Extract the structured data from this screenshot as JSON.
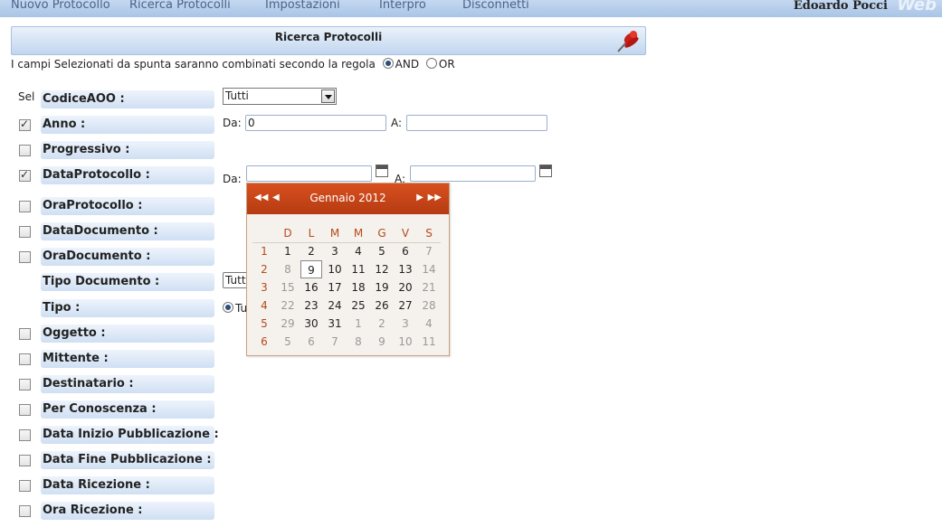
{
  "nav": {
    "items": [
      "Nuovo Protocollo",
      "Ricerca Protocolli",
      "Impostazioni",
      "Interpro",
      "Disconnetti"
    ],
    "user": "Edoardo Pocci",
    "brand": "Web"
  },
  "section": {
    "title": "Ricerca Protocolli"
  },
  "rule": {
    "text": "I campi Selezionati da spunta saranno combinati secondo la regola",
    "and": "AND",
    "or": "OR",
    "selected": "AND"
  },
  "sel_label": "Sel",
  "fields": [
    {
      "label": "CodiceAOO :",
      "check": "none"
    },
    {
      "label": "Anno :",
      "check": "checked"
    },
    {
      "label": "Progressivo :",
      "check": "unchecked"
    },
    {
      "label": "DataProtocollo :",
      "check": "checked"
    },
    {
      "label": "OraProtocollo :",
      "check": "unchecked"
    },
    {
      "label": "DataDocumento :",
      "check": "unchecked"
    },
    {
      "label": "OraDocumento :",
      "check": "unchecked"
    },
    {
      "label": "Tipo Documento :",
      "check": "none"
    },
    {
      "label": "Tipo :",
      "check": "none"
    },
    {
      "label": "Oggetto :",
      "check": "unchecked"
    },
    {
      "label": "Mittente :",
      "check": "unchecked"
    },
    {
      "label": "Destinatario :",
      "check": "unchecked"
    },
    {
      "label": "Per Conoscenza :",
      "check": "unchecked"
    },
    {
      "label": "Data Inizio Pubblicazione :",
      "check": "unchecked"
    },
    {
      "label": "Data Fine Pubblicazione :",
      "check": "unchecked"
    },
    {
      "label": "Data Ricezione :",
      "check": "unchecked"
    },
    {
      "label": "Ora Ricezione :",
      "check": "unchecked"
    }
  ],
  "codiceaoo": {
    "value": "Tutti"
  },
  "anno": {
    "da_label": "Da:",
    "a_label": "A:",
    "da_value": "0",
    "a_value": ""
  },
  "dataprot": {
    "da_label": "Da:",
    "a_label": "A:"
  },
  "tipodoc": {
    "value": "Tutti"
  },
  "tipo": {
    "value": "Tu"
  },
  "calendar": {
    "month": "Gennaio 2012",
    "dow": [
      "D",
      "L",
      "M",
      "M",
      "G",
      "V",
      "S"
    ],
    "weeks": [
      {
        "wk": "1",
        "days": [
          {
            "d": "1",
            "c": "cur"
          },
          {
            "d": "2",
            "c": "cur"
          },
          {
            "d": "3",
            "c": "cur"
          },
          {
            "d": "4",
            "c": "cur"
          },
          {
            "d": "5",
            "c": "cur"
          },
          {
            "d": "6",
            "c": "cur"
          },
          {
            "d": "7",
            "c": "oth"
          }
        ]
      },
      {
        "wk": "2",
        "days": [
          {
            "d": "8",
            "c": "oth"
          },
          {
            "d": "9",
            "c": "today"
          },
          {
            "d": "10",
            "c": "cur"
          },
          {
            "d": "11",
            "c": "cur"
          },
          {
            "d": "12",
            "c": "cur"
          },
          {
            "d": "13",
            "c": "cur"
          },
          {
            "d": "14",
            "c": "oth"
          }
        ]
      },
      {
        "wk": "3",
        "days": [
          {
            "d": "15",
            "c": "oth"
          },
          {
            "d": "16",
            "c": "cur"
          },
          {
            "d": "17",
            "c": "cur"
          },
          {
            "d": "18",
            "c": "cur"
          },
          {
            "d": "19",
            "c": "cur"
          },
          {
            "d": "20",
            "c": "cur"
          },
          {
            "d": "21",
            "c": "oth"
          }
        ]
      },
      {
        "wk": "4",
        "days": [
          {
            "d": "22",
            "c": "oth"
          },
          {
            "d": "23",
            "c": "cur"
          },
          {
            "d": "24",
            "c": "cur"
          },
          {
            "d": "25",
            "c": "cur"
          },
          {
            "d": "26",
            "c": "cur"
          },
          {
            "d": "27",
            "c": "cur"
          },
          {
            "d": "28",
            "c": "oth"
          }
        ]
      },
      {
        "wk": "5",
        "days": [
          {
            "d": "29",
            "c": "oth"
          },
          {
            "d": "30",
            "c": "cur"
          },
          {
            "d": "31",
            "c": "cur"
          },
          {
            "d": "1",
            "c": "oth"
          },
          {
            "d": "2",
            "c": "oth"
          },
          {
            "d": "3",
            "c": "oth"
          },
          {
            "d": "4",
            "c": "oth"
          }
        ]
      },
      {
        "wk": "6",
        "days": [
          {
            "d": "5",
            "c": "oth"
          },
          {
            "d": "6",
            "c": "oth"
          },
          {
            "d": "7",
            "c": "oth"
          },
          {
            "d": "8",
            "c": "oth"
          },
          {
            "d": "9",
            "c": "oth"
          },
          {
            "d": "10",
            "c": "oth"
          },
          {
            "d": "11",
            "c": "oth"
          }
        ]
      }
    ]
  },
  "colors": {
    "nav_bg": "#a9c4e6",
    "calendar_header": "#c4461a",
    "weekday_text": "#b74a1c"
  }
}
